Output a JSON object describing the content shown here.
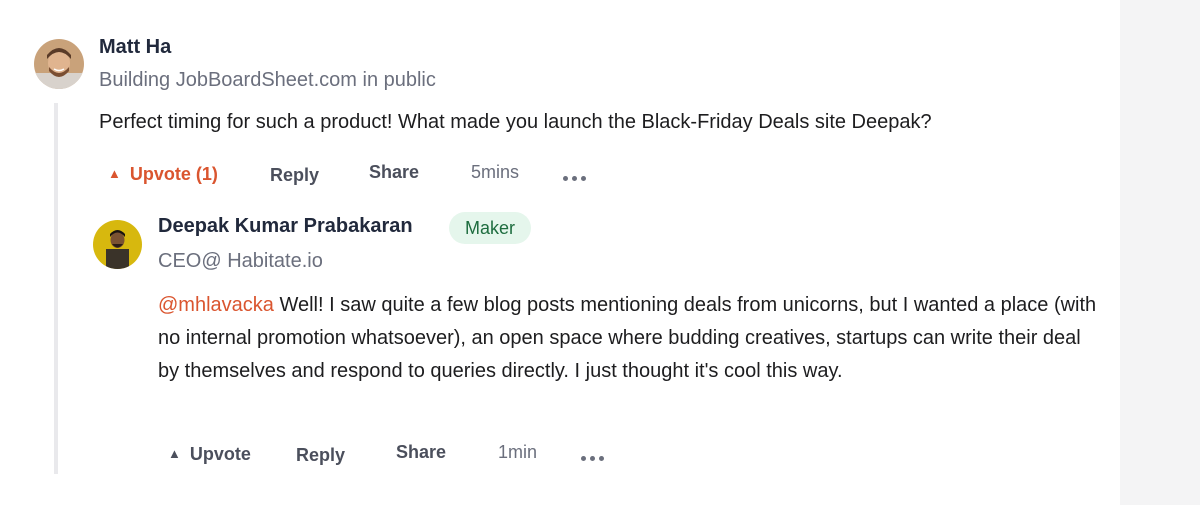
{
  "colors": {
    "accent": "#da552f",
    "maker_badge_bg": "#e5f6ec",
    "maker_badge_text": "#1e6d3f",
    "muted_text": "#6b6f7d",
    "sidebar_bg": "#f4f4f5"
  },
  "comment": {
    "author": "Matt Ha",
    "headline": "Building JobBoardSheet.com in public",
    "body": "Perfect timing for such a product! What made you launch the Black-Friday Deals site Deepak?",
    "actions": {
      "upvote_label": "Upvote (1)",
      "upvote_icon": "upvote-triangle-icon",
      "reply_label": "Reply",
      "share_label": "Share",
      "timestamp": "5mins",
      "more_icon": "more-dots-icon"
    }
  },
  "reply": {
    "author": "Deepak Kumar Prabakaran",
    "badge": "Maker",
    "headline": "CEO@ Habitate.io",
    "mention": "@mhlavacka",
    "body": " Well! I saw quite a few blog posts mentioning deals from unicorns, but I wanted a place (with no internal promotion whatsoever), an open space where budding creatives, startups can write their deal by themselves and respond to queries directly. I just thought it's cool this way.",
    "actions": {
      "upvote_label": "Upvote",
      "upvote_icon": "upvote-triangle-icon",
      "reply_label": "Reply",
      "share_label": "Share",
      "timestamp": "1min",
      "more_icon": "more-dots-icon"
    }
  }
}
